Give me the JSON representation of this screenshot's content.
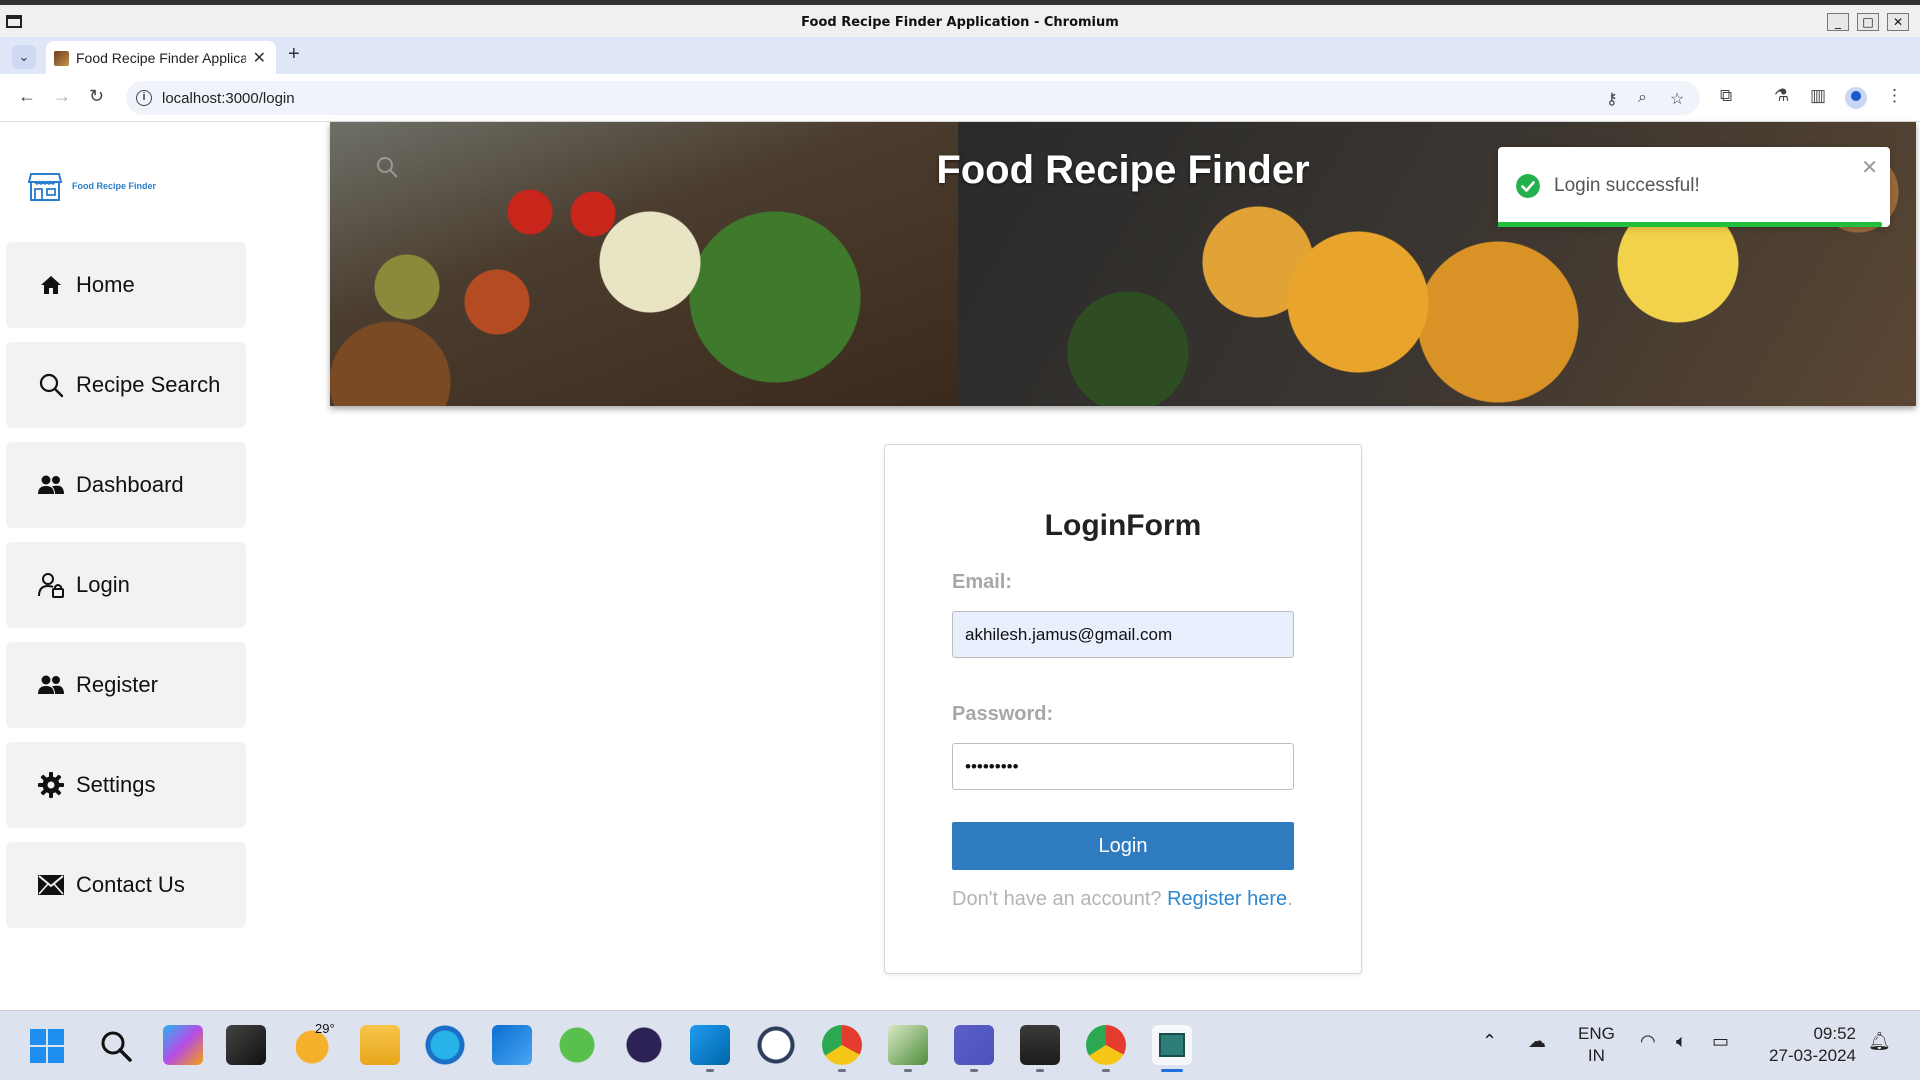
{
  "window": {
    "title": "Food Recipe Finder Application - Chromium",
    "minimize_glyph": "_",
    "maximize_glyph": "□",
    "close_glyph": "✕"
  },
  "browser": {
    "tab_title": "Food Recipe Finder Application",
    "new_tab_glyph": "+",
    "url": "localhost:3000/login"
  },
  "app": {
    "brand_name": "Food Recipe Finder",
    "hero_title": "Food Recipe Finder",
    "nav": [
      {
        "label": "Home",
        "icon": "home-icon"
      },
      {
        "label": "Recipe Search",
        "icon": "search-icon"
      },
      {
        "label": "Dashboard",
        "icon": "users-icon"
      },
      {
        "label": "Login",
        "icon": "user-lock-icon"
      },
      {
        "label": "Register",
        "icon": "users-icon"
      },
      {
        "label": "Settings",
        "icon": "gear-icon"
      },
      {
        "label": "Contact Us",
        "icon": "envelope-icon"
      }
    ]
  },
  "login_form": {
    "title": "LoginForm",
    "email_label": "Email:",
    "email_value": "akhilesh.jamus@gmail.com",
    "password_label": "Password:",
    "password_value": "•••••••••",
    "submit_label": "Login",
    "footer_prompt": "Don't have an account?",
    "register_link": "Register here",
    "footer_period": "."
  },
  "toast": {
    "message": "Login successful!",
    "status_color": "#22b14c",
    "progress": 0.98
  },
  "taskbar": {
    "weather_temp": "29°",
    "language_line1": "ENG",
    "language_line2": "IN",
    "time": "09:52",
    "date": "27-03-2024"
  },
  "colors": {
    "primary_button": "#2f7bbf",
    "link": "#2e88cf",
    "sidebar_item_bg": "#f2f2f2"
  }
}
